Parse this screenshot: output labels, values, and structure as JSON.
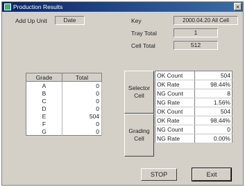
{
  "window": {
    "title": "Production Results",
    "close": "×"
  },
  "header": {
    "add_up_unit_label": "Add Up Unit",
    "add_up_unit_value": "Date",
    "key_label": "Key",
    "key_value": "2000.04.20 All Cell",
    "tray_total_label": "Tray Total",
    "tray_total_value": "1",
    "cell_total_label": "Cell Total",
    "cell_total_value": "512"
  },
  "grade_table": {
    "columns": [
      "Grade",
      "Total"
    ],
    "rows": [
      {
        "grade": "A",
        "total": "0"
      },
      {
        "grade": "B",
        "total": "0"
      },
      {
        "grade": "C",
        "total": "0"
      },
      {
        "grade": "D",
        "total": "0"
      },
      {
        "grade": "E",
        "total": "504"
      },
      {
        "grade": "F",
        "total": "0"
      },
      {
        "grade": "G",
        "total": "0"
      }
    ]
  },
  "stats": {
    "selector_label": "Selector Cell",
    "grading_label": "Grading Cell",
    "selector_rows": [
      {
        "key": "OK Count",
        "value": "504"
      },
      {
        "key": "OK Rate",
        "value": "98.44%"
      },
      {
        "key": "NG Count",
        "value": "8"
      },
      {
        "key": "NG Rate",
        "value": "1.56%"
      }
    ],
    "grading_rows": [
      {
        "key": "OK Count",
        "value": "504"
      },
      {
        "key": "OK Rate",
        "value": "98.44%"
      },
      {
        "key": "NG Count",
        "value": "0"
      },
      {
        "key": "NG Rate",
        "value": "0.00%"
      }
    ]
  },
  "buttons": {
    "stop": "STOP",
    "exit": "Exit"
  }
}
